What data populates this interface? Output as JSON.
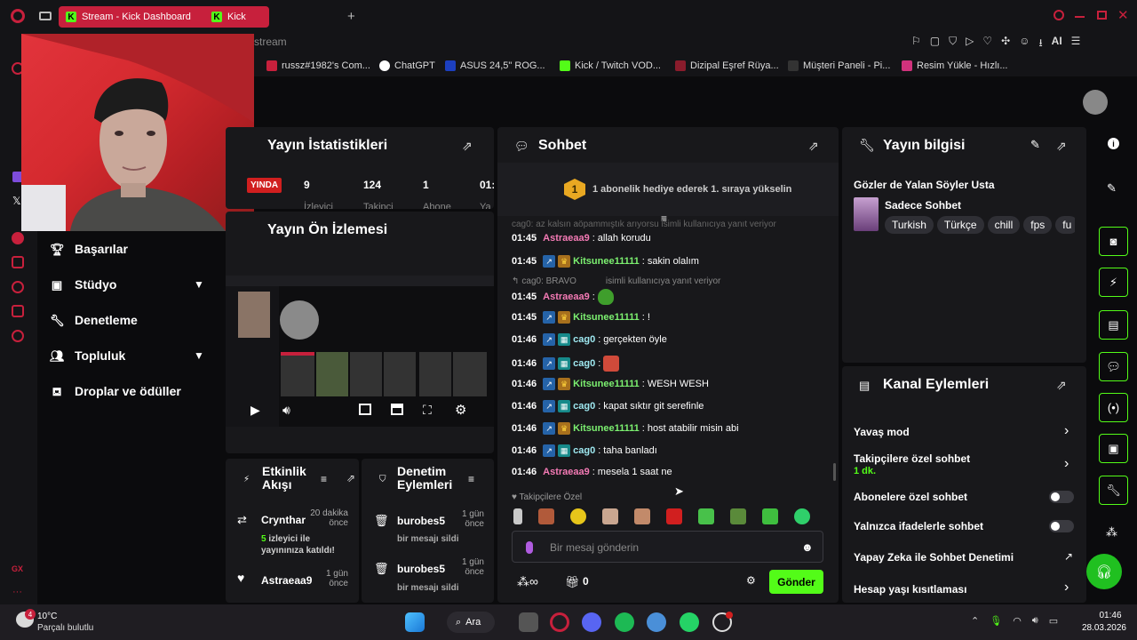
{
  "browser": {
    "tabs": [
      {
        "label": "Stream - Kick Dashboard",
        "active": true
      },
      {
        "label": "Kick",
        "active": false
      }
    ],
    "address_fragment": "stream",
    "bookmarks": [
      {
        "label": "russz#1982's Com...",
        "color": "#c7203c"
      },
      {
        "label": "ChatGPT",
        "color": "#ffffff"
      },
      {
        "label": "ASUS 24,5\" ROG...",
        "color": "#1c3fbf"
      },
      {
        "label": "Kick / Twitch VOD...",
        "color": "#53fc18"
      },
      {
        "label": "Dizipal Eşref Rüya...",
        "color": "#8a1c2c"
      },
      {
        "label": "Müşteri Paneli - Pi...",
        "color": "#222222"
      },
      {
        "label": "Resim Yükle - Hızlı...",
        "color": "#d0327c"
      }
    ],
    "toolbar_ai_label": "AI"
  },
  "left_nav": {
    "items": [
      {
        "label": "Başarılar",
        "icon": "trophy-icon"
      },
      {
        "label": "Stüdyo",
        "icon": "studio-icon",
        "expandable": true
      },
      {
        "label": "Denetleme",
        "icon": "wrench-icon"
      },
      {
        "label": "Topluluk",
        "icon": "community-icon",
        "expandable": true
      },
      {
        "label": "Droplar ve ödüller",
        "icon": "gift-icon"
      }
    ],
    "gx_label": "GX"
  },
  "stats_panel": {
    "title": "Yayın İstatistikleri",
    "live_badge": "YINDA",
    "stats": [
      {
        "value": "9",
        "label": "İzleyici"
      },
      {
        "value": "124",
        "label": "Takipçi"
      },
      {
        "value": "1",
        "label": "Abone"
      },
      {
        "value": "01:",
        "label": "Ya"
      }
    ]
  },
  "preview_panel": {
    "title": "Yayın Ön İzlemesi"
  },
  "activity_panel": {
    "title": "Etkinlik Akışı",
    "items": [
      {
        "user": "Crynthar",
        "time": "20 dakika önce",
        "detail_count": "5",
        "detail": "izleyici ile yayınınıza katıldı!"
      },
      {
        "user": "Astraeaa9",
        "time": "1 gün önce",
        "detail_count": "",
        "detail": ""
      }
    ]
  },
  "moderation_panel": {
    "title": "Denetim Eylemleri",
    "items": [
      {
        "user": "burobes5",
        "time": "1 gün önce",
        "detail": "bir mesajı sildi"
      },
      {
        "user": "burobes5",
        "time": "1 gün önce",
        "detail": "bir mesajı sildi"
      }
    ]
  },
  "chat_panel": {
    "title": "Sohbet",
    "pinned_rank": "1",
    "pinned_text": "1 abonelik hediye ederek 1. sıraya yükselin",
    "faded_top": "cag0: az kalsın aöpammıştık arıyorsu isimli kullanıcıya yanıt veriyor",
    "messages": [
      {
        "time": "01:45",
        "user": "Astraeaa9",
        "color": "pink",
        "badges": [],
        "text": "allah korudu"
      },
      {
        "time": "01:45",
        "user": "Kitsunee11111",
        "color": "green",
        "badges": [
          "blue",
          "crown"
        ],
        "text": "sakin olalım"
      },
      {
        "time": "01:45",
        "user": "Astraeaa9",
        "color": "pink",
        "badges": [],
        "text": "",
        "reply": "cag0: BRAVO",
        "reply_suffix": "isimli kullanıcıya yanıt veriyor",
        "emote": "#3f9e2c"
      },
      {
        "time": "01:45",
        "user": "Kitsunee11111",
        "color": "green",
        "badges": [
          "blue",
          "crown"
        ],
        "text": "!"
      },
      {
        "time": "01:46",
        "user": "cag0",
        "color": "cyan",
        "badges": [
          "blue",
          "teal"
        ],
        "text": "gerçekten öyle"
      },
      {
        "time": "01:46",
        "user": "cag0",
        "color": "cyan",
        "badges": [
          "blue",
          "teal"
        ],
        "text": "",
        "emote": "#d04a3a"
      },
      {
        "time": "01:46",
        "user": "Kitsunee11111",
        "color": "green",
        "badges": [
          "blue",
          "crown"
        ],
        "text": "WESH WESH"
      },
      {
        "time": "01:46",
        "user": "cag0",
        "color": "cyan",
        "badges": [
          "blue",
          "teal"
        ],
        "text": "kapat sıktır git serefinle"
      },
      {
        "time": "01:46",
        "user": "Kitsunee11111",
        "color": "green",
        "badges": [
          "blue",
          "crown"
        ],
        "text": "host atabilir misin abi"
      },
      {
        "time": "01:46",
        "user": "cag0",
        "color": "cyan",
        "badges": [
          "blue",
          "teal"
        ],
        "text": "taha banladı"
      },
      {
        "time": "01:46",
        "user": "Astraeaa9",
        "color": "pink",
        "badges": [],
        "text": "mesela 1 saat ne"
      }
    ],
    "followers_only_label": "Takipçilere Özel",
    "emote_colors": [
      "#c9c9c9",
      "#b15a3a",
      "#e7c61a",
      "#c9a690",
      "#c28a6a",
      "#d11f1f",
      "#48c14a",
      "#5a8a3a",
      "#3fbf3f",
      "#2fcf6a"
    ],
    "input_placeholder": "Bir mesaj gönderin",
    "points_value": "0",
    "send_label": "Gönder"
  },
  "stream_info_panel": {
    "title": "Yayın bilgisi",
    "stream_title": "Gözler de Yalan Söyler Usta",
    "category": "Sadece Sohbet",
    "tags": [
      "Turkish",
      "Türkçe",
      "chill",
      "fps",
      "fu"
    ]
  },
  "channel_actions_panel": {
    "title": "Kanal Eylemleri",
    "items": [
      {
        "label": "Yavaş mod",
        "control": "chevron"
      },
      {
        "label": "Takipçilere özel sohbet",
        "sub": "1 dk.",
        "control": "chevron"
      },
      {
        "label": "Abonelere özel sohbet",
        "control": "toggle"
      },
      {
        "label": "Yalnızca ifadelerle sohbet",
        "control": "toggle"
      },
      {
        "label": "Yapay Zeka ile Sohbet Denetimi",
        "control": "external"
      },
      {
        "label": "Hesap yaşı kısıtlaması",
        "control": "chevron"
      }
    ]
  },
  "taskbar": {
    "weather_badge": "4",
    "temperature": "10°C",
    "condition": "Parçalı bulutlu",
    "search_label": "Ara",
    "time": "01:46",
    "date": "28.03.2026"
  }
}
